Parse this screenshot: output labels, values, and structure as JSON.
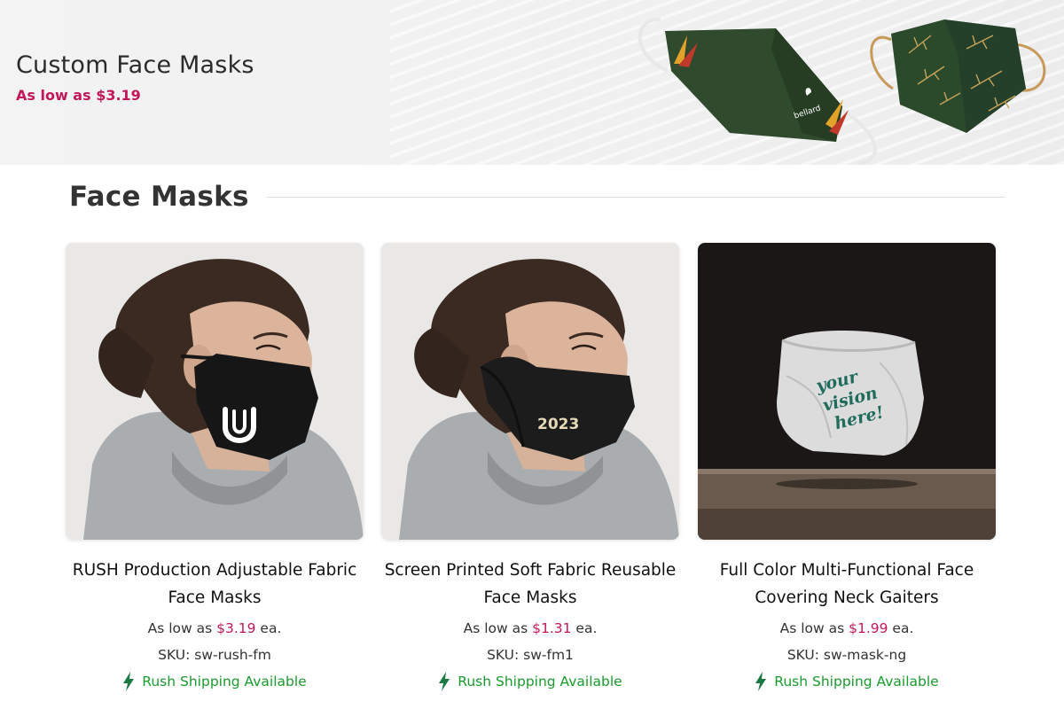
{
  "hero": {
    "title": "Custom Face Masks",
    "subtitle": "As low as $3.19",
    "subtitle_color": "#c2185b",
    "mask_brand_text": "bellard"
  },
  "section": {
    "title": "Face Masks"
  },
  "products": [
    {
      "title": "RUSH Production Adjustable Fabric Face Masks",
      "price_prefix": "As low as",
      "price": "$3.19",
      "price_suffix": "ea.",
      "sku": "SKU: sw-rush-fm",
      "rush": "Rush Shipping Available",
      "image": "model-black-mask-u-logo"
    },
    {
      "title": "Screen Printed Soft Fabric Reusable Face Masks",
      "price_prefix": "As low as",
      "price": "$1.31",
      "price_suffix": "ea.",
      "sku": "SKU: sw-fm1",
      "rush": "Rush Shipping Available",
      "image": "model-black-mask-2023-logo",
      "mask_print": "2023"
    },
    {
      "title": "Full Color Multi-Functional Face Covering Neck Gaiters",
      "price_prefix": "As low as",
      "price": "$1.99",
      "price_suffix": "ea.",
      "sku": "SKU: sw-mask-ng",
      "rush": "Rush Shipping Available",
      "image": "neck-gaiter-your-vision-here",
      "gaiter_print": [
        "your",
        "vision",
        "here!"
      ]
    }
  ],
  "colors": {
    "price_accent": "#c2185b",
    "rush_green": "#1a9b2e",
    "mask_green": "#2f4a2c"
  },
  "icons": {
    "rush": "lightning-bolt-icon"
  }
}
